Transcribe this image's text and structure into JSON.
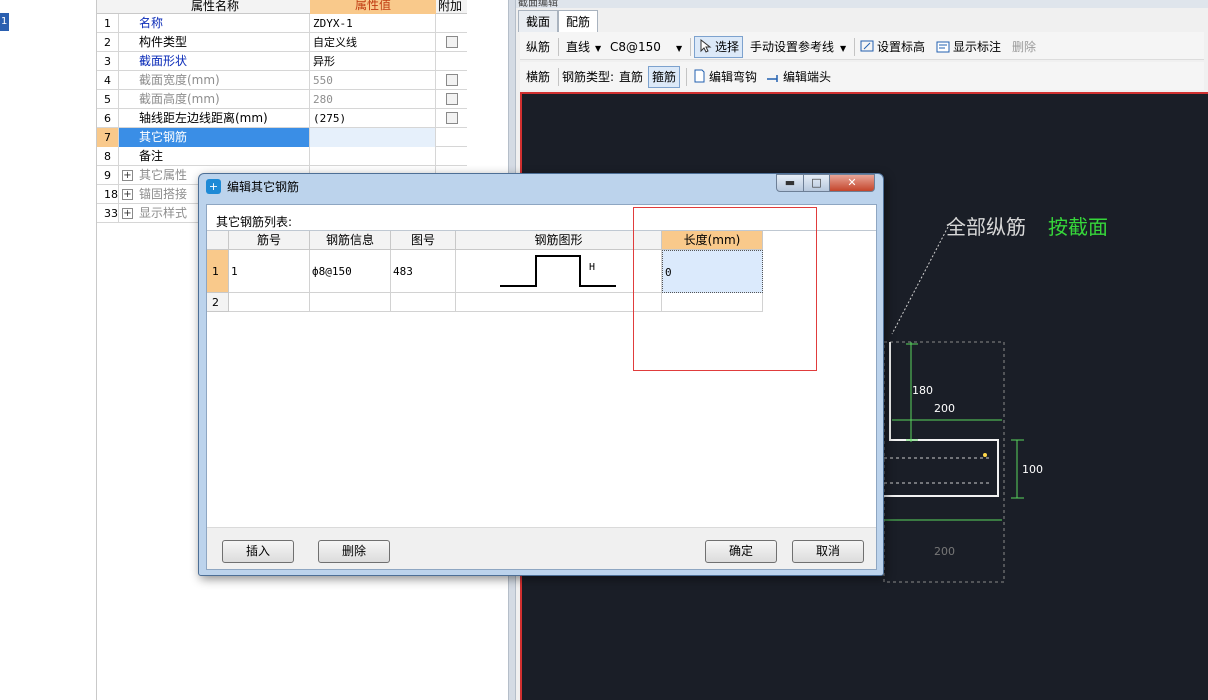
{
  "left_strip": {
    "selected_label": "1"
  },
  "property_grid": {
    "headers": {
      "name": "属性名称",
      "value": "属性值",
      "add": "附加"
    },
    "rows": [
      {
        "num": "1",
        "name": "名称",
        "value": "ZDYX-1",
        "style": "blue",
        "checkbox": false
      },
      {
        "num": "2",
        "name": "构件类型",
        "value": "自定义线",
        "style": "normal",
        "checkbox": true
      },
      {
        "num": "3",
        "name": "截面形状",
        "value": "异形",
        "style": "blue",
        "checkbox": false
      },
      {
        "num": "4",
        "name": "截面宽度(mm)",
        "value": "550",
        "style": "grey",
        "checkbox": true
      },
      {
        "num": "5",
        "name": "截面高度(mm)",
        "value": "280",
        "style": "grey",
        "checkbox": true
      },
      {
        "num": "6",
        "name": "轴线距左边线距离(mm)",
        "value": "(275)",
        "style": "normal",
        "checkbox": true
      },
      {
        "num": "7",
        "name": "其它钢筋",
        "value": "",
        "style": "selected",
        "checkbox": false
      },
      {
        "num": "8",
        "name": "备注",
        "value": "",
        "style": "normal",
        "checkbox": false
      },
      {
        "num": "9",
        "name": "其它属性",
        "value": "",
        "style": "grey-group",
        "checkbox": false
      },
      {
        "num": "18",
        "name": "锚固搭接",
        "value": "",
        "style": "grey-group",
        "checkbox": false
      },
      {
        "num": "33",
        "name": "显示样式",
        "value": "",
        "style": "grey-group",
        "checkbox": false
      }
    ]
  },
  "right_panel": {
    "title": "截面编辑",
    "tabs": [
      {
        "label": "截面"
      },
      {
        "label": "配筋"
      }
    ],
    "toolbar1": {
      "longitudinal": "纵筋",
      "line_type": "直线",
      "rebar_spec": "C8@150",
      "select": "选择",
      "manual_ref": "手动设置参考线",
      "set_elevation": "设置标高",
      "show_label": "显示标注",
      "delete": "删除"
    },
    "toolbar2": {
      "transverse": "横筋",
      "rebar_type_label": "钢筋类型:",
      "straight": "直筋",
      "stirrup": "箍筋",
      "edit_hook": "编辑弯钩",
      "edit_end": "编辑端头"
    },
    "canvas": {
      "annotation_prefix": "全部纵筋",
      "annotation_suffix": "按截面",
      "dim_180": "180",
      "dim_200_top": "200",
      "dim_100": "100",
      "dim_200_bottom": "200",
      "colors": {
        "background": "#1a1e27",
        "dim_line": "#59d65e",
        "section": "#f2f2f2",
        "annotation_green": "#36d63a"
      }
    }
  },
  "dialog": {
    "title": "编辑其它钢筋",
    "list_label": "其它钢筋列表:",
    "columns": [
      "筋号",
      "钢筋信息",
      "图号",
      "钢筋图形",
      "长度(mm)"
    ],
    "rows": [
      {
        "num": "1",
        "bar_no": "1",
        "info": "ф8@150",
        "figure_no": "483",
        "shape_label": "H",
        "length": "0"
      },
      {
        "num": "2",
        "bar_no": "",
        "info": "",
        "figure_no": "",
        "shape_label": "",
        "length": ""
      }
    ],
    "buttons": {
      "insert": "插入",
      "delete": "删除",
      "ok": "确定",
      "cancel": "取消"
    },
    "window_buttons": {
      "minimize": "▬",
      "maximize": "□",
      "close": "✕"
    }
  }
}
